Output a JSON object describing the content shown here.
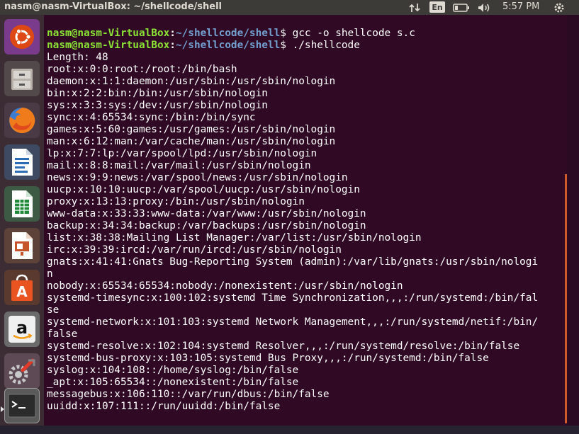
{
  "topbar": {
    "window_title": "nasm@nasm-VirtualBox: ~/shellcode/shell",
    "indicators": {
      "network": "network-arrows-icon",
      "keyboard_layout": "En",
      "battery": "battery-icon",
      "volume": "speaker-icon",
      "clock": "5:57 PM",
      "session": "power-gear-icon"
    }
  },
  "launcher": {
    "items": [
      {
        "name": "ubuntu-dash-icon",
        "color": "#dd4814"
      },
      {
        "name": "files-icon",
        "color": "#8b8580"
      },
      {
        "name": "firefox-icon",
        "color": "#e66000"
      },
      {
        "name": "libreoffice-writer-icon",
        "color": "#2a6fb5"
      },
      {
        "name": "libreoffice-calc-icon",
        "color": "#1e8a3a"
      },
      {
        "name": "libreoffice-impress-icon",
        "color": "#c5552a"
      },
      {
        "name": "ubuntu-software-icon",
        "color": "#e95420"
      },
      {
        "name": "amazon-icon",
        "color": "#f0f0f0"
      },
      {
        "name": "system-settings-icon",
        "color": "#9a9a9a"
      },
      {
        "name": "terminal-icon",
        "color": "#2b2b2b"
      }
    ]
  },
  "terminal": {
    "user_host": "nasm@nasm-VirtualBox",
    "path": "~/shellcode/shell",
    "commands": [
      {
        "cmd": "gcc -o shellcode s.c"
      },
      {
        "cmd": "./shellcode"
      }
    ],
    "output": [
      "Length: 48",
      "root:x:0:0:root:/root:/bin/bash",
      "daemon:x:1:1:daemon:/usr/sbin:/usr/sbin/nologin",
      "bin:x:2:2:bin:/bin:/usr/sbin/nologin",
      "sys:x:3:3:sys:/dev:/usr/sbin/nologin",
      "sync:x:4:65534:sync:/bin:/bin/sync",
      "games:x:5:60:games:/usr/games:/usr/sbin/nologin",
      "man:x:6:12:man:/var/cache/man:/usr/sbin/nologin",
      "lp:x:7:7:lp:/var/spool/lpd:/usr/sbin/nologin",
      "mail:x:8:8:mail:/var/mail:/usr/sbin/nologin",
      "news:x:9:9:news:/var/spool/news:/usr/sbin/nologin",
      "uucp:x:10:10:uucp:/var/spool/uucp:/usr/sbin/nologin",
      "proxy:x:13:13:proxy:/bin:/usr/sbin/nologin",
      "www-data:x:33:33:www-data:/var/www:/usr/sbin/nologin",
      "backup:x:34:34:backup:/var/backups:/usr/sbin/nologin",
      "list:x:38:38:Mailing List Manager:/var/list:/usr/sbin/nologin",
      "irc:x:39:39:ircd:/var/run/ircd:/usr/sbin/nologin",
      "gnats:x:41:41:Gnats Bug-Reporting System (admin):/var/lib/gnats:/usr/sbin/nologi",
      "n",
      "nobody:x:65534:65534:nobody:/nonexistent:/usr/sbin/nologin",
      "systemd-timesync:x:100:102:systemd Time Synchronization,,,:/run/systemd:/bin/fal",
      "se",
      "systemd-network:x:101:103:systemd Network Management,,,:/run/systemd/netif:/bin/",
      "false",
      "systemd-resolve:x:102:104:systemd Resolver,,,:/run/systemd/resolve:/bin/false",
      "systemd-bus-proxy:x:103:105:systemd Bus Proxy,,,:/run/systemd:/bin/false",
      "syslog:x:104:108::/home/syslog:/bin/false",
      "_apt:x:105:65534::/nonexistent:/bin/false",
      "messagebus:x:106:110::/var/run/dbus:/bin/false",
      "uuidd:x:107:111::/run/uuidd:/bin/false"
    ],
    "colors": {
      "background": "#300a24",
      "user": "#8ae234",
      "path": "#729fcf",
      "text": "#ffffff"
    }
  }
}
